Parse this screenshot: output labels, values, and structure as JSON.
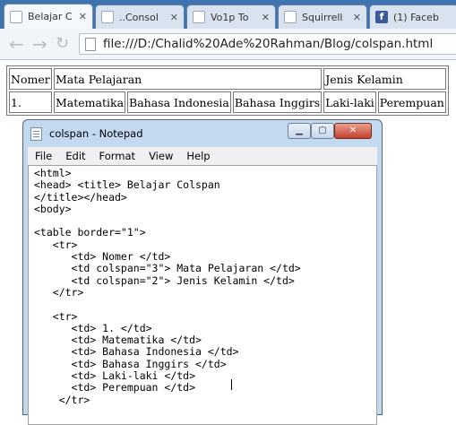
{
  "tabs": [
    {
      "title": "Belajar C",
      "favicon": "page-icon",
      "active": true
    },
    {
      "title": "..Consol",
      "favicon": "page-icon",
      "active": false
    },
    {
      "title": "Vo1p To",
      "favicon": "page-icon",
      "active": false
    },
    {
      "title": "Squirrell",
      "favicon": "page-icon",
      "active": false
    },
    {
      "title": "(1) Faceb",
      "favicon": "facebook-icon",
      "active": false
    }
  ],
  "toolbar": {
    "back_icon": "back-arrow-icon",
    "forward_icon": "forward-arrow-icon",
    "url": "file:///D:/Chalid%20Ade%20Rahman/Blog/colspan.html"
  },
  "page_table": {
    "header": [
      "Nomer",
      "Mata Pelajaran",
      "Jenis Kelamin"
    ],
    "row": [
      "1.",
      "Matematika",
      "Bahasa Indonesia",
      "Bahasa Inggirs",
      "Laki-laki",
      "Perempuan"
    ]
  },
  "notepad": {
    "title": "colspan - Notepad",
    "menu": [
      "File",
      "Edit",
      "Format",
      "View",
      "Help"
    ],
    "code": "<html>\n<head> <title> Belajar Colspan\n</title></head>\n<body>\n\n<table border=\"1\">\n   <tr>\n      <td> Nomer </td>\n      <td colspan=\"3\"> Mata Pelajaran </td>\n      <td colspan=\"2\"> Jenis Kelamin </td>\n   </tr>\n\n   <tr>\n      <td> 1. </td>\n      <td> Matematika </td>\n      <td> Bahasa Indonesia </td>\n      <td> Bahasa Inggirs </td>\n      <td> Laki-laki </td>\n      <td> Perempuan </td>\n    </tr>"
  }
}
